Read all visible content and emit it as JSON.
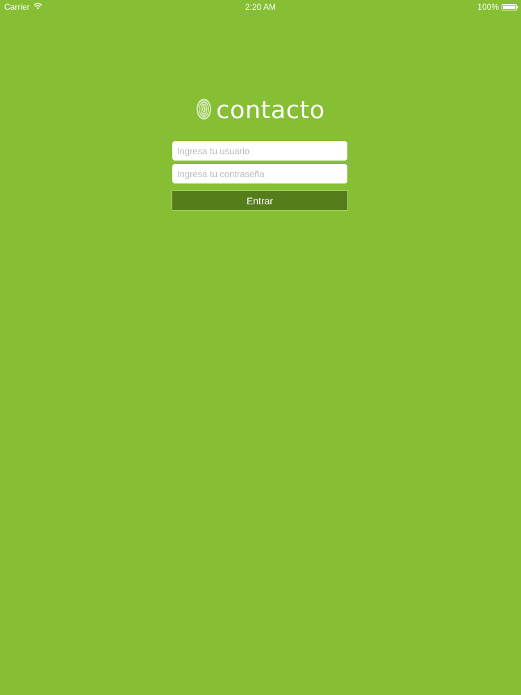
{
  "status_bar": {
    "carrier": "Carrier",
    "time": "2:20 AM",
    "battery_text": "100%",
    "battery_level": 1.0
  },
  "logo": {
    "text": "contacto",
    "icon": "fingerprint-icon"
  },
  "login_form": {
    "username_placeholder": "Ingresa tu usuario",
    "username_value": "",
    "password_placeholder": "Ingresa tu contraseña",
    "password_value": "",
    "submit_label": "Entrar"
  },
  "colors": {
    "background": "#86bf33",
    "button": "#567d1c",
    "text": "#ffffff"
  }
}
